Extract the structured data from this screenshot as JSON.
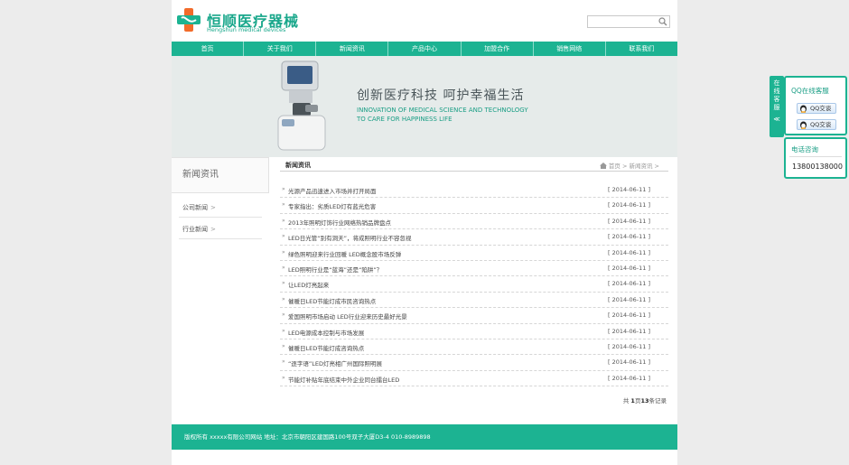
{
  "header": {
    "logo_cn": "恒顺医疗器械",
    "logo_en": "Hengshun medical devices",
    "search_placeholder": ""
  },
  "nav": [
    "首页",
    "关于我们",
    "新闻资讯",
    "产品中心",
    "加盟合作",
    "销售网络",
    "联系我们"
  ],
  "banner": {
    "slogan_cn": "创新医疗科技  呵护幸福生活",
    "slogan_en_1": "INNOVATION OF MEDICAL SCIENCE AND TECHNOLOGY",
    "slogan_en_2": "TO CARE FOR HAPPINESS LIFE"
  },
  "sidebar": {
    "title": "新闻资讯",
    "links": [
      {
        "label": "公司新闻",
        "arrow": ">"
      },
      {
        "label": "行业新闻",
        "arrow": ">"
      }
    ]
  },
  "content": {
    "title": "新闻资讯",
    "breadcrumb": {
      "home": "首页",
      "sep": ">",
      "current": "新闻资讯",
      "tail": ">"
    },
    "news": [
      {
        "title": "光源产品迅速进入市场并打开局面",
        "date": "[ 2014-06-11 ]"
      },
      {
        "title": "专家指出：劣质LED灯有蓝光危害",
        "date": "[ 2014-06-11 ]"
      },
      {
        "title": "2013年照明灯饰行业网络热销品牌盘点",
        "date": "[ 2014-06-11 ]"
      },
      {
        "title": "LED日光管“别有洞天”，将成照明行业不容忽视",
        "date": "[ 2014-06-11 ]"
      },
      {
        "title": "绿色照明迎来行业回暖 LED概念股市场反弹",
        "date": "[ 2014-06-11 ]"
      },
      {
        "title": "LED照明行业是“蓝海”还是“陷阱”？",
        "date": "[ 2014-06-11 ]"
      },
      {
        "title": "让LED灯亮起来",
        "date": "[ 2014-06-11 ]"
      },
      {
        "title": "催暖日LED节能灯成市民咨询热点",
        "date": "[ 2014-06-11 ]"
      },
      {
        "title": "爱国照明市场启动 LED行业迎来历史最好光景",
        "date": "[ 2014-06-11 ]"
      },
      {
        "title": "LED电源成本控制与市场发展",
        "date": "[ 2014-06-11 ]"
      },
      {
        "title": "催暖日LED节能灯成咨询热点",
        "date": "[ 2014-06-11 ]"
      },
      {
        "title": "“逐字语”LED灯亮相广州国际照明展",
        "date": "[ 2014-06-11 ]"
      },
      {
        "title": "节能灯补贴年底结束中外企业同台擂台LED",
        "date": "[ 2014-06-11 ]"
      }
    ],
    "pager": {
      "prefix": "共",
      "page": "1",
      "mid": "页",
      "count": "13",
      "suffix": "条记录"
    }
  },
  "footer": {
    "text": "版权所有 xxxxx有限公司网站  地址：北京市朝阳区建国路100号双子大厦D3-4 010-8989898"
  },
  "float_panel": {
    "tab_label": [
      "在",
      "线",
      "客",
      "服",
      "≪"
    ],
    "qq_title": "QQ在线客服",
    "qq_buttons": [
      "QQ交谈",
      "QQ交谈"
    ],
    "tel_title": "电话咨询",
    "tel_number": "13800138000"
  },
  "colors": {
    "accent": "#1cb392",
    "accent_text": "#1a9e85",
    "background": "#ececec"
  }
}
